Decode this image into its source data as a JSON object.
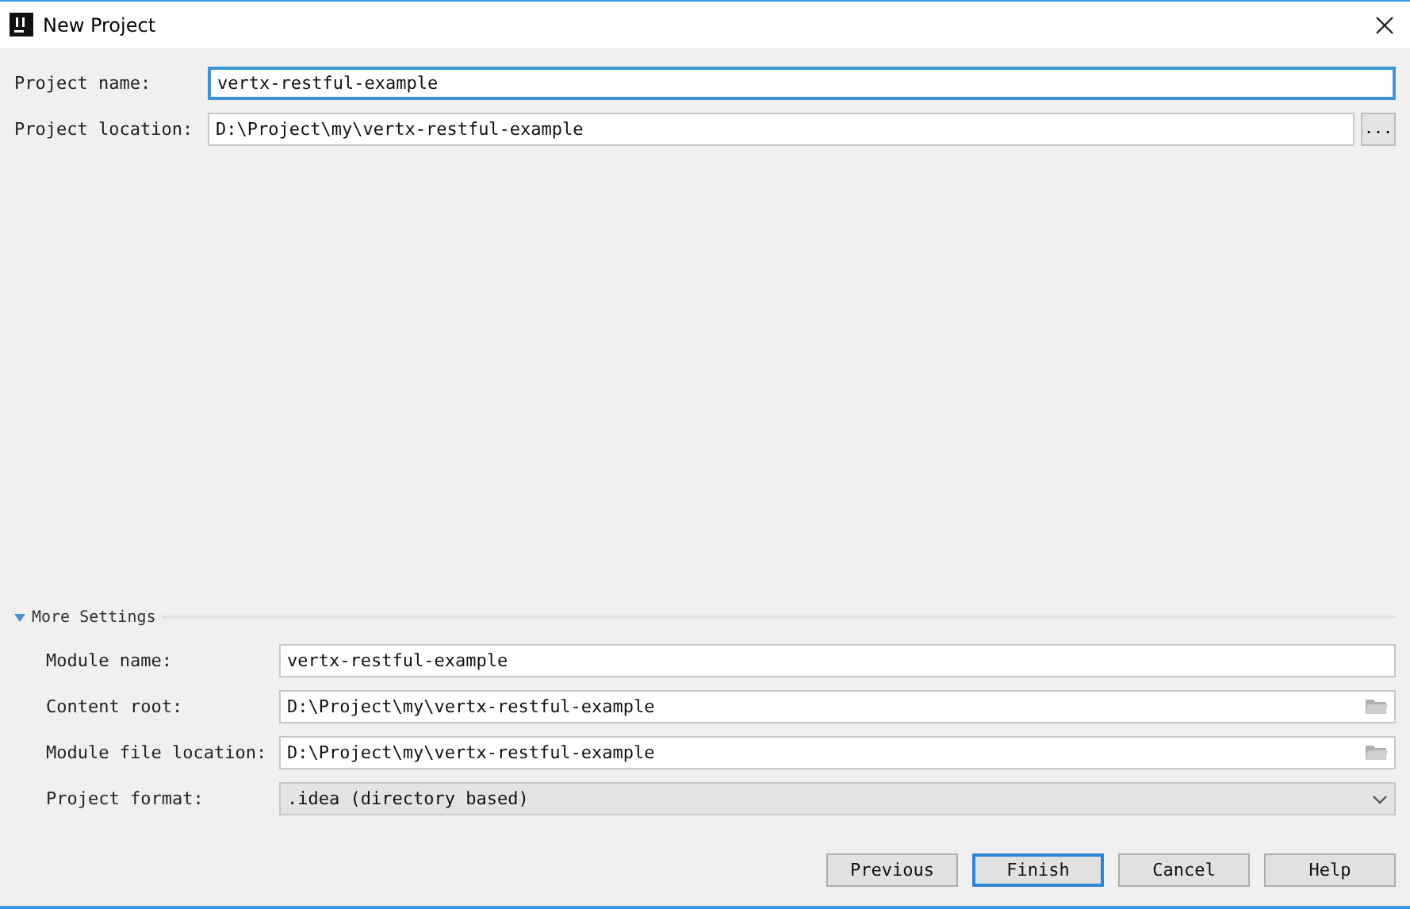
{
  "window": {
    "title": "New Project"
  },
  "project_fields": [
    {
      "label": "Project name:",
      "value": "vertx-restful-example",
      "focused": true,
      "kind": "text"
    },
    {
      "label": "Project location:",
      "value": "D:\\Project\\my\\vertx-restful-example",
      "focused": false,
      "kind": "ellipsis",
      "button": "..."
    }
  ],
  "more_settings": {
    "title": "More Settings",
    "expanded": true,
    "fields": [
      {
        "label": "Module name:",
        "value": "vertx-restful-example",
        "kind": "text"
      },
      {
        "label": "Content root:",
        "value": "D:\\Project\\my\\vertx-restful-example",
        "kind": "folder"
      },
      {
        "label": "Module file location:",
        "value": "D:\\Project\\my\\vertx-restful-example",
        "kind": "folder"
      },
      {
        "label": "Project format:",
        "value": ".idea (directory based)",
        "kind": "dropdown"
      }
    ]
  },
  "buttons": [
    {
      "label": "Previous",
      "default": false
    },
    {
      "label": "Finish",
      "default": true
    },
    {
      "label": "Cancel",
      "default": false
    },
    {
      "label": "Help",
      "default": false
    }
  ]
}
